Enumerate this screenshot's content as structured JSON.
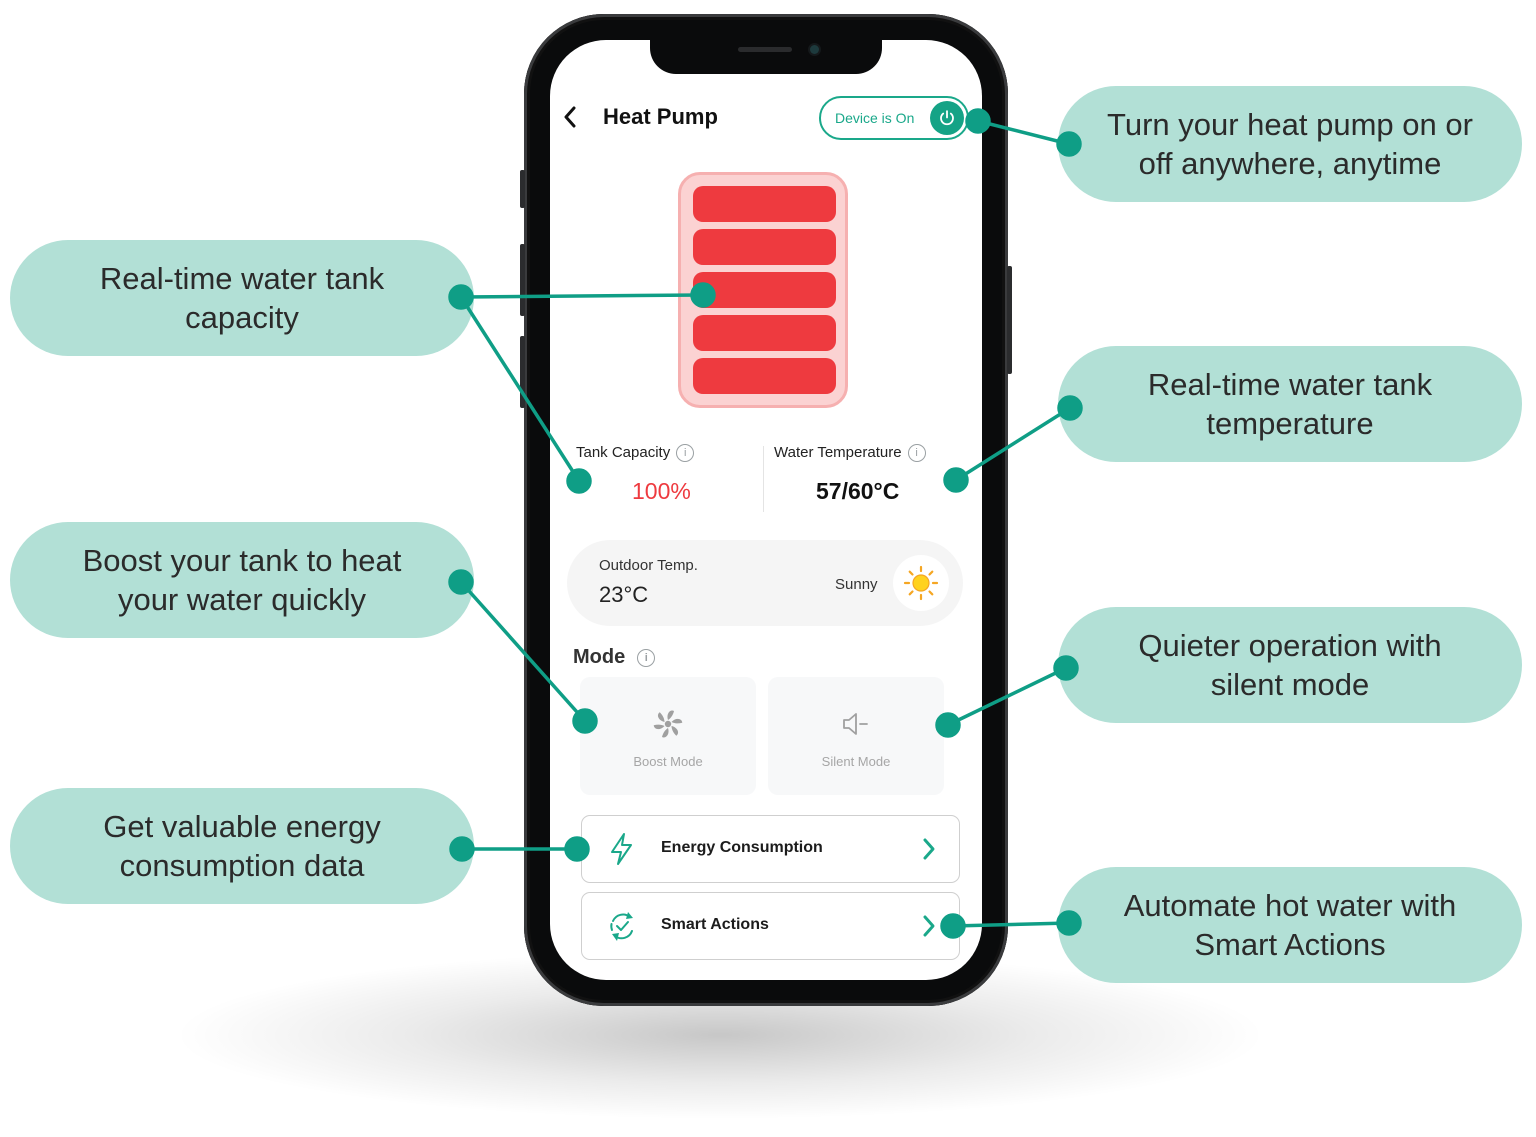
{
  "app": {
    "title": "Heat Pump",
    "back_icon": "chevron-left-icon",
    "device_status_label": "Device is On",
    "power_icon": "power-icon",
    "device_on": true
  },
  "tank": {
    "level_percent": 100,
    "segments_filled": 5,
    "segments_total": 5,
    "color_fill": "#ee3a3f",
    "color_bg": "#fbd2d2"
  },
  "stats": {
    "tank_capacity_label": "Tank Capacity",
    "tank_capacity_value": "100%",
    "water_temp_label": "Water Temperature",
    "water_temp_value": "57/60°C",
    "info_glyph": "i"
  },
  "outdoor": {
    "label": "Outdoor Temp.",
    "value": "23°C",
    "condition": "Sunny",
    "weather_icon": "sun-icon"
  },
  "mode": {
    "label": "Mode",
    "options": [
      {
        "label": "Boost Mode",
        "icon": "fan-icon"
      },
      {
        "label": "Silent Mode",
        "icon": "speaker-mute-icon"
      }
    ]
  },
  "actions": [
    {
      "label": "Energy Consumption",
      "icon": "lightning-icon"
    },
    {
      "label": "Smart Actions",
      "icon": "refresh-check-icon"
    }
  ],
  "callouts": {
    "power": "Turn your heat pump on or\noff anywhere, anytime",
    "tank_capacity": "Real-time water tank\ncapacity",
    "tank_temperature": "Real-time water tank\ntemperature",
    "boost": "Boost your tank to heat\nyour water quickly",
    "silent": "Quieter operation with\nsilent mode",
    "energy": "Get valuable energy\nconsumption data",
    "smart_actions": "Automate hot water with\nSmart Actions"
  },
  "colors": {
    "accent": "#15a386",
    "callout_bg": "#b2e0d6",
    "connector": "#0f9e86"
  }
}
